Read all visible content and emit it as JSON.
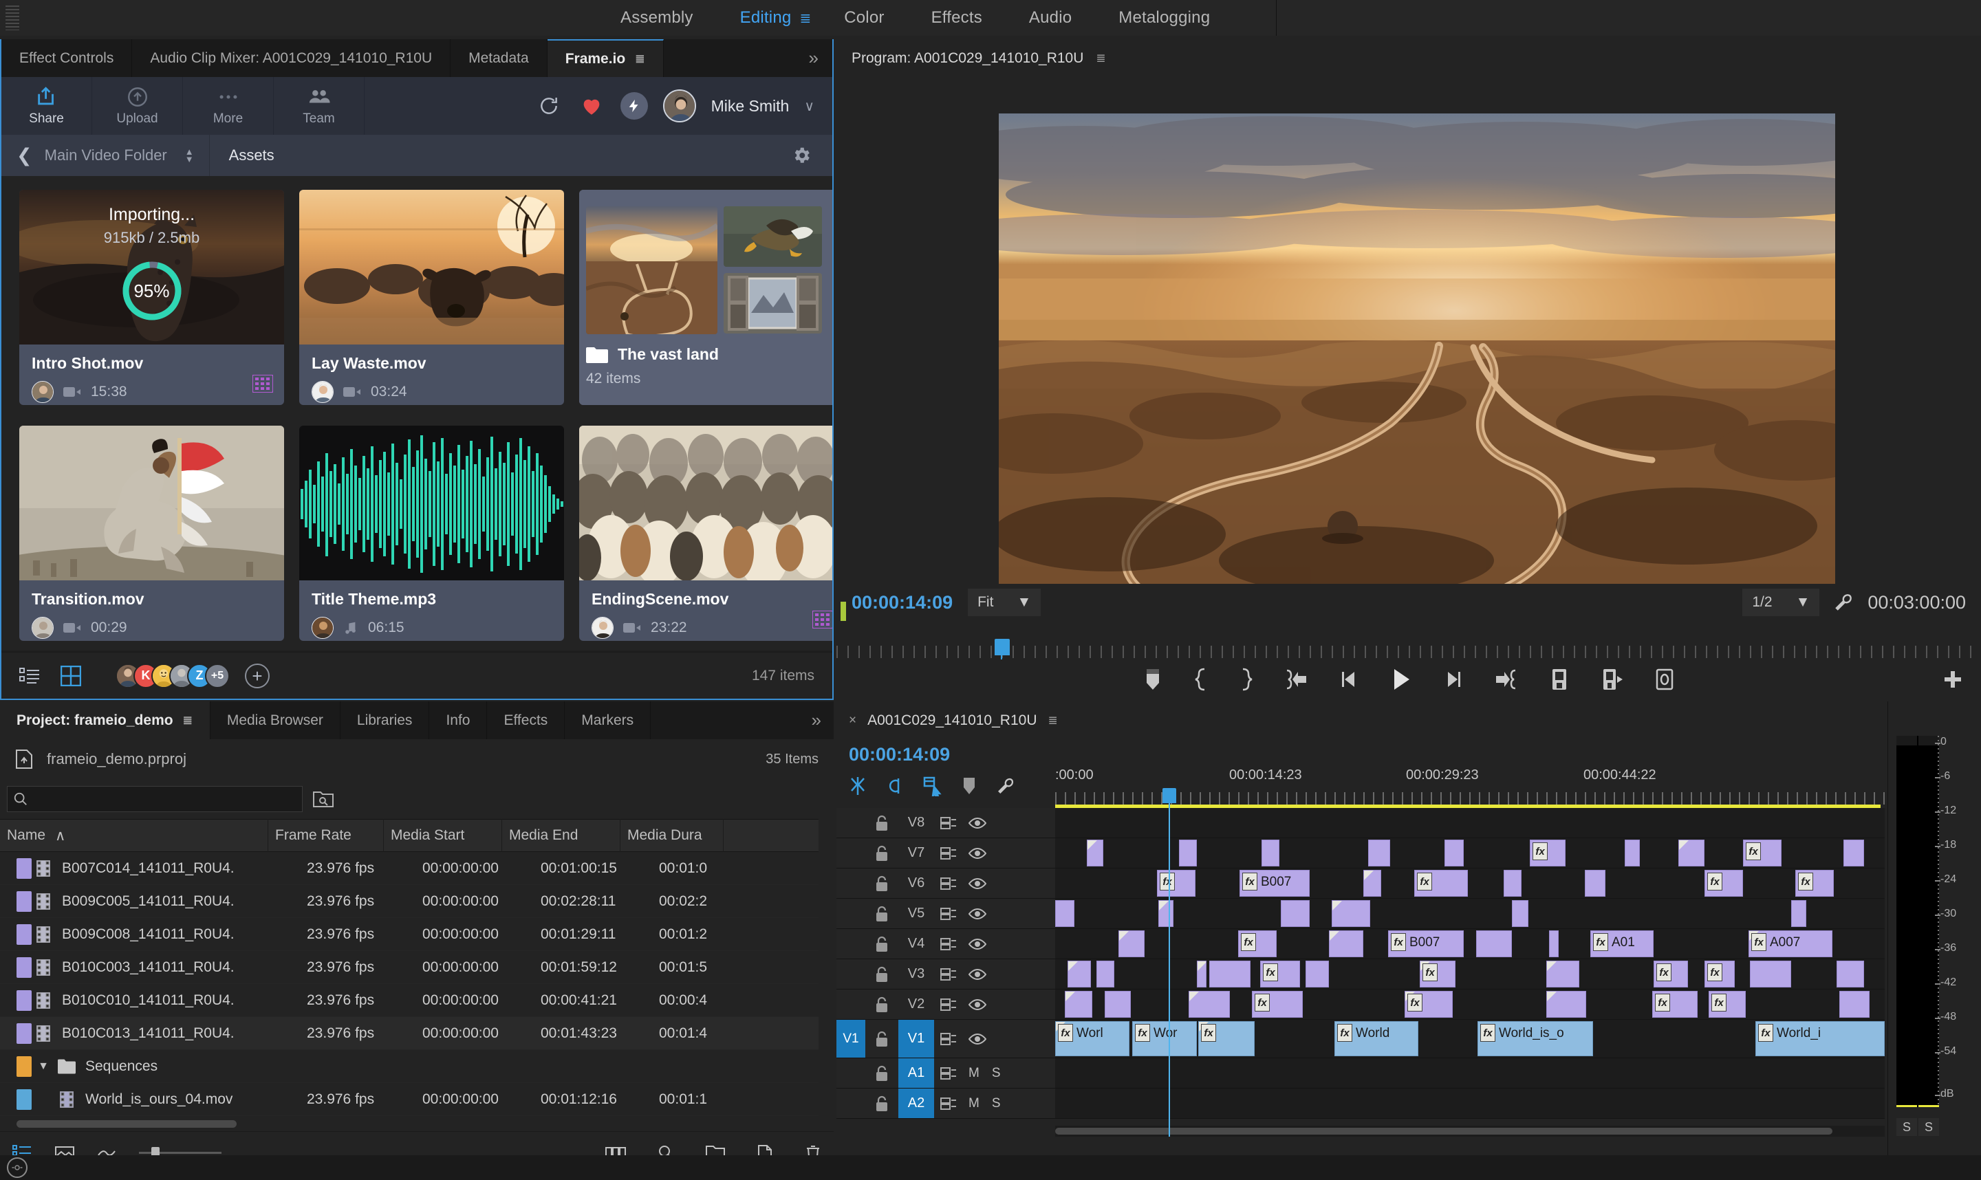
{
  "workspace": {
    "tabs": [
      {
        "label": "Assembly",
        "active": false
      },
      {
        "label": "Editing",
        "active": true
      },
      {
        "label": "Color",
        "active": false
      },
      {
        "label": "Effects",
        "active": false
      },
      {
        "label": "Audio",
        "active": false
      },
      {
        "label": "Metalogging",
        "active": false
      }
    ]
  },
  "source_panel": {
    "tabs": [
      {
        "label": "Effect Controls",
        "active": false
      },
      {
        "label": "Audio Clip Mixer: A001C029_141010_R10U",
        "active": false
      },
      {
        "label": "Metadata",
        "active": false
      },
      {
        "label": "Frame.io",
        "active": true
      }
    ],
    "more_label": "»"
  },
  "frameio": {
    "toolbar": [
      {
        "label": "Share",
        "icon": "share-icon"
      },
      {
        "label": "Upload",
        "icon": "upload-icon"
      },
      {
        "label": "More",
        "icon": "more-icon"
      },
      {
        "label": "Team",
        "icon": "team-icon"
      }
    ],
    "refresh_icon": "refresh-icon",
    "heart_icon": "heart-icon",
    "bolt_icon": "bolt-icon",
    "user_name": "Mike Smith",
    "chevron": "∨",
    "breadcrumb": {
      "back_icon": "chevron-left-icon",
      "parent": "Main Video Folder",
      "current": "Assets",
      "gear_icon": "gear-icon"
    },
    "assets": [
      {
        "name": "Intro Shot.mov",
        "duration": "15:38",
        "type": "video",
        "importing": true,
        "import_label": "Importing...",
        "import_size": "915kb / 2.5mb",
        "import_percent": "95%",
        "has_film_badge": true
      },
      {
        "name": "Lay Waste.mov",
        "duration": "03:24",
        "type": "video",
        "importing": false,
        "has_film_badge": false
      },
      {
        "name": "The vast land",
        "is_folder": true,
        "item_count": "42 items"
      },
      {
        "name": "Transition.mov",
        "duration": "00:29",
        "type": "video",
        "importing": false,
        "has_film_badge": false
      },
      {
        "name": "Title Theme.mp3",
        "duration": "06:15",
        "type": "audio",
        "importing": false,
        "has_film_badge": false
      },
      {
        "name": "EndingScene.mov",
        "duration": "23:22",
        "type": "video",
        "importing": false,
        "has_film_badge": true
      }
    ],
    "footer": {
      "list_view_icon": "list-view-icon",
      "grid_view_icon": "grid-view-icon",
      "collaborators": [
        "",
        "K",
        "",
        "",
        "Z"
      ],
      "collaborator_overflow": "+5",
      "add_icon": "plus-icon",
      "items_count": "147 items"
    }
  },
  "project": {
    "tabs": [
      {
        "label": "Project: frameio_demo",
        "active": true
      },
      {
        "label": "Media Browser",
        "active": false
      },
      {
        "label": "Libraries",
        "active": false
      },
      {
        "label": "Info",
        "active": false
      },
      {
        "label": "Effects",
        "active": false
      },
      {
        "label": "Markers",
        "active": false
      }
    ],
    "more_label": "»",
    "file_name": "frameio_demo.prproj",
    "item_count": "35 Items",
    "search_placeholder": "",
    "search_value": "",
    "columns": [
      "Name",
      "Frame Rate",
      "Media Start",
      "Media End",
      "Media Dura"
    ],
    "sort_arrow": "∧",
    "rows": [
      {
        "name": "B007C014_141011_R0U4.",
        "frame_rate": "23.976 fps",
        "media_start": "00:00:00:00",
        "media_end": "00:01:00:15",
        "media_duration": "00:01:0",
        "color": "#a79ae0",
        "kind": "clip"
      },
      {
        "name": "B009C005_141011_R0U4.",
        "frame_rate": "23.976 fps",
        "media_start": "00:00:00:00",
        "media_end": "00:02:28:11",
        "media_duration": "00:02:2",
        "color": "#a79ae0",
        "kind": "clip"
      },
      {
        "name": "B009C008_141011_R0U4.",
        "frame_rate": "23.976 fps",
        "media_start": "00:00:00:00",
        "media_end": "00:01:29:11",
        "media_duration": "00:01:2",
        "color": "#a79ae0",
        "kind": "clip"
      },
      {
        "name": "B010C003_141011_R0U4.",
        "frame_rate": "23.976 fps",
        "media_start": "00:00:00:00",
        "media_end": "00:01:59:12",
        "media_duration": "00:01:5",
        "color": "#a79ae0",
        "kind": "clip"
      },
      {
        "name": "B010C010_141011_R0U4.",
        "frame_rate": "23.976 fps",
        "media_start": "00:00:00:00",
        "media_end": "00:00:41:21",
        "media_duration": "00:00:4",
        "color": "#a79ae0",
        "kind": "clip"
      },
      {
        "name": "B010C013_141011_R0U4.",
        "frame_rate": "23.976 fps",
        "media_start": "00:00:00:00",
        "media_end": "00:01:43:23",
        "media_duration": "00:01:4",
        "color": "#a79ae0",
        "kind": "clip",
        "selected": true
      },
      {
        "name": "Sequences",
        "frame_rate": "",
        "media_start": "",
        "media_end": "",
        "media_duration": "",
        "color": "#e8a33c",
        "kind": "bin"
      },
      {
        "name": "World_is_ours_04.mov",
        "frame_rate": "23.976 fps",
        "media_start": "00:00:00:00",
        "media_end": "00:01:12:16",
        "media_duration": "00:01:1",
        "color": "#5aa8d8",
        "kind": "sequence"
      }
    ]
  },
  "program": {
    "title": "Program: A001C029_141010_R10U",
    "playhead_timecode": "00:00:14:09",
    "zoom_level": "Fit",
    "resolution": "1/2",
    "duration_timecode": "00:03:00:00",
    "wrench_icon": "wrench-icon",
    "transport": [
      {
        "icon": "add-marker-icon",
        "name": "add-marker-button"
      },
      {
        "icon": "mark-in-icon",
        "name": "mark-in-button"
      },
      {
        "icon": "mark-out-icon",
        "name": "mark-out-button"
      },
      {
        "icon": "go-to-in-icon",
        "name": "go-to-in-button"
      },
      {
        "icon": "step-back-icon",
        "name": "step-back-button"
      },
      {
        "icon": "play-icon",
        "name": "play-button"
      },
      {
        "icon": "step-forward-icon",
        "name": "step-forward-button"
      },
      {
        "icon": "go-to-out-icon",
        "name": "go-to-out-button"
      },
      {
        "icon": "lift-icon",
        "name": "lift-button"
      },
      {
        "icon": "extract-icon",
        "name": "extract-button"
      },
      {
        "icon": "export-frame-icon",
        "name": "export-frame-button"
      }
    ],
    "button_editor_icon": "plus-icon"
  },
  "timeline": {
    "title": "A001C029_141010_R10U",
    "close_icon": "×",
    "playhead_timecode": "00:00:14:09",
    "tools": [
      "snap-icon",
      "linked-selection-icon",
      "add-marker-icon",
      "marker-icon",
      "wrench-icon"
    ],
    "ruler_labels": [
      ":00:00",
      "00:00:14:23",
      "00:00:29:23",
      "00:00:44:22"
    ],
    "tracks": [
      {
        "name": "V8",
        "type": "video",
        "selected": false
      },
      {
        "name": "V7",
        "type": "video",
        "selected": false
      },
      {
        "name": "V6",
        "type": "video",
        "selected": false
      },
      {
        "name": "V5",
        "type": "video",
        "selected": false
      },
      {
        "name": "V4",
        "type": "video",
        "selected": false
      },
      {
        "name": "V3",
        "type": "video",
        "selected": false
      },
      {
        "name": "V2",
        "type": "video",
        "selected": false
      },
      {
        "name": "V1",
        "type": "video",
        "selected": true,
        "target": "V1"
      },
      {
        "name": "A1",
        "type": "audio",
        "selected": true,
        "mute": "M",
        "solo": "S"
      },
      {
        "name": "A2",
        "type": "audio",
        "selected": true,
        "mute": "M",
        "solo": "S"
      }
    ],
    "clip_labels": [
      "B007",
      "B007",
      "A01",
      "A007",
      "Worl",
      "Wor",
      "World",
      "World_is_o",
      "World_i"
    ]
  },
  "audio_meters": {
    "scale": [
      "0",
      "-6",
      "-12",
      "-18",
      "-24",
      "-30",
      "-36",
      "-42",
      "-48",
      "-54",
      "dB"
    ],
    "solo_buttons": [
      "S",
      "S"
    ]
  },
  "colors": {
    "accent_blue": "#3a8fd4",
    "playhead_blue": "#4ba3e3",
    "frameio_teal": "#2fd6b4",
    "heart_red": "#e84b4b",
    "clip_purple": "#b7a8e8",
    "clip_audio_blue": "#8fbce0",
    "work_area_yellow": "#e8e83c"
  }
}
